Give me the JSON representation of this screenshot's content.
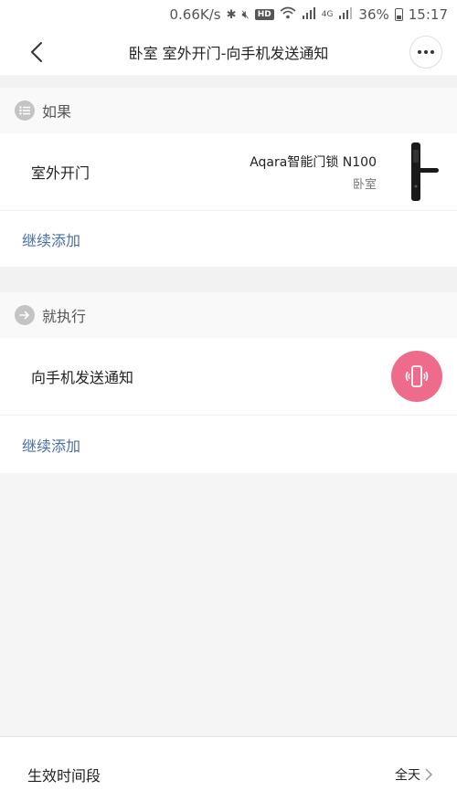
{
  "status_bar": {
    "speed": "0.66K/s",
    "hd": "HD",
    "network": "4G",
    "battery": "36%",
    "time": "15:17"
  },
  "header": {
    "title": "卧室 室外开门-向手机发送通知"
  },
  "condition_section": {
    "heading": "如果",
    "trigger": {
      "label": "室外开门",
      "device": "Aqara智能门锁 N100",
      "room": "卧室"
    },
    "add_more": "继续添加"
  },
  "action_section": {
    "heading": "就执行",
    "action": {
      "label": "向手机发送通知"
    },
    "add_more": "继续添加"
  },
  "bottom": {
    "label": "生效时间段",
    "value": "全天"
  },
  "colors": {
    "accent_link": "#4a6ea8",
    "notify_bg": "#ee6b8c"
  }
}
